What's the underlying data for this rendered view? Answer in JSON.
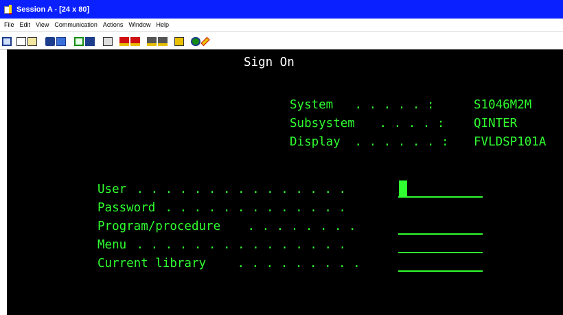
{
  "window": {
    "title": "Session A - [24 x 80]"
  },
  "menu": [
    "File",
    "Edit",
    "View",
    "Communication",
    "Actions",
    "Window",
    "Help"
  ],
  "toolbar": {
    "icons": [
      "print-screen-icon",
      "copy-icon",
      "paste-icon",
      "send-icon",
      "receive-icon",
      "display-icon",
      "keypad-icon",
      "macro-record-icon",
      "macro-play-icon",
      "macro-stop-icon",
      "transfer-send-icon",
      "transfer-receive-icon",
      "clipboard-icon",
      "globe-icon",
      "pencil-icon"
    ],
    "colors": {
      "icon_blue": "#1c3c8c",
      "icon_red": "#d01010",
      "icon_yellow": "#e8c000",
      "icon_green": "#148c14"
    }
  },
  "screen": {
    "title": "Sign On",
    "info": [
      {
        "label": "System",
        "dots": " . . . . . :",
        "value": "S1046M2M"
      },
      {
        "label": "Subsystem",
        "dots": " . . . . :",
        "value": "QINTER"
      },
      {
        "label": "Display",
        "dots": " . . . . . . :",
        "value": "FVLDSP101A"
      }
    ],
    "fields": [
      {
        "label": "User",
        "dots": " . . . . . . . . . . . . . . .",
        "value": ""
      },
      {
        "label": "Password",
        "dots": " . . . . . . . . . . . . .",
        "value": ""
      },
      {
        "label": "Program/procedure",
        "dots": " . . . . . . . .",
        "value": ""
      },
      {
        "label": "Menu",
        "dots": " . . . . . . . . . . . . . . .",
        "value": ""
      },
      {
        "label": "Current library",
        "dots": " . . . . . . . . .",
        "value": ""
      }
    ],
    "colors": {
      "background": "#000000",
      "text_green": "#30ff30",
      "title_white": "#ffffff"
    }
  }
}
